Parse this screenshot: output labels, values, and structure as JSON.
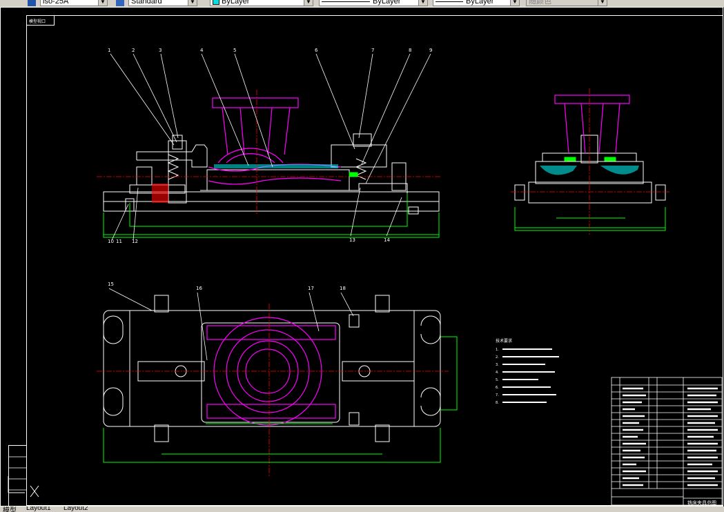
{
  "toolbar": {
    "text_style": "iso-25A",
    "dim_style": "Standard",
    "layer": "ByLayer",
    "linetype": "ByLayer",
    "lineweight": "ByLayer",
    "plotstyle": "随颜色"
  },
  "drawing": {
    "frame_label": "模型视口",
    "balloons": [
      "1",
      "2",
      "3",
      "4",
      "5",
      "6",
      "7",
      "8",
      "9",
      "10",
      "11",
      "12",
      "13",
      "14",
      "15",
      "16",
      "17",
      "18"
    ],
    "requirements_title": "技术要求",
    "requirements": [
      "1.",
      "2.",
      "3.",
      "4.",
      "5.",
      "6.",
      "7.",
      "8."
    ],
    "title_block": {
      "title": "铣床夹具总图"
    }
  },
  "tabs": {
    "model": "模型",
    "layout1": "Layout1",
    "layout2": "Layout2"
  },
  "colors": {
    "background": "#000000",
    "frame": "#ffffff",
    "magenta": "#ff00ff",
    "green": "#00ff00",
    "red": "#ff0000",
    "cyan": "#00ffff"
  }
}
